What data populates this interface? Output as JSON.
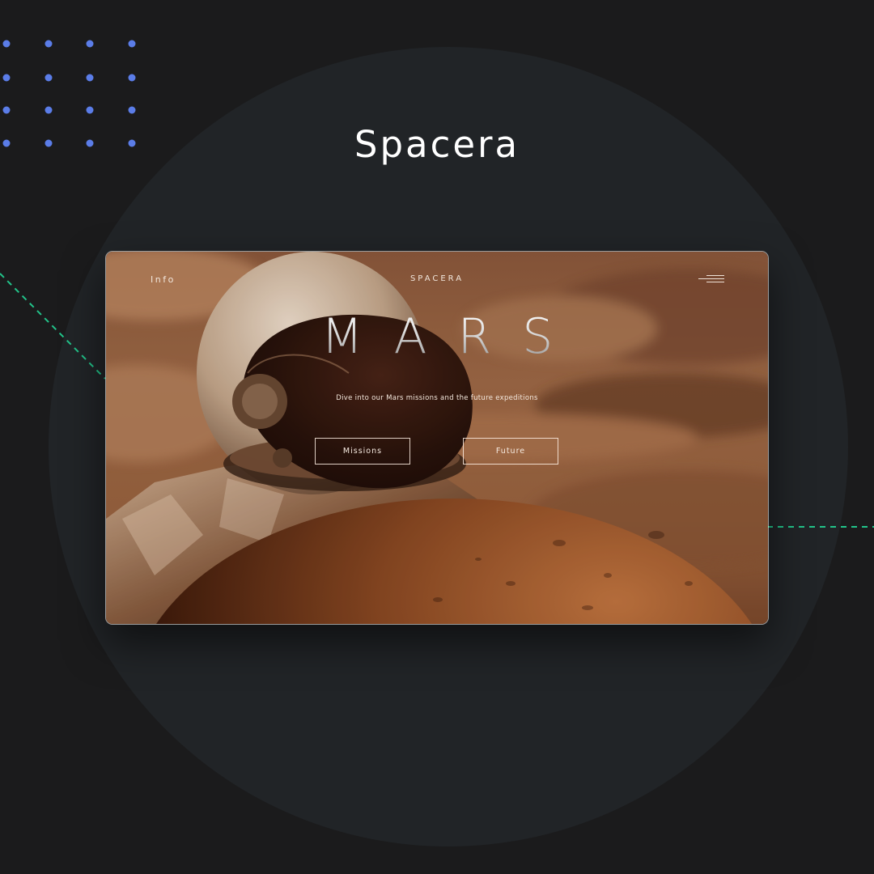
{
  "brand": {
    "title": "Spacera"
  },
  "hero": {
    "nav": {
      "info_label": "Info",
      "logo_text": "SPACERA",
      "menu_icon": "hamburger-menu-icon"
    },
    "title": "MARS",
    "subtitle": "Dive into our Mars missions and the future expeditions",
    "buttons": {
      "missions_label": "Missions",
      "future_label": "Future"
    }
  },
  "colors": {
    "background": "#1b1b1c",
    "circle": "#212427",
    "dots": "#5b7de8",
    "dashed_lines": "#22c48a",
    "mars_tint": "#a0603a"
  }
}
